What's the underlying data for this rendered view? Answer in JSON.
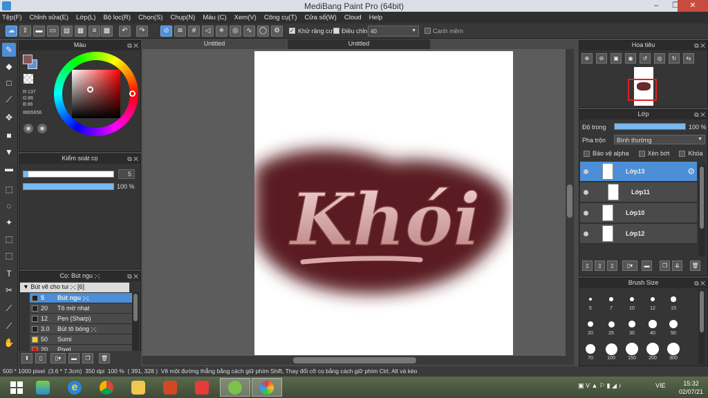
{
  "window": {
    "title": "MediBang Paint Pro (64bit)",
    "minimize": "‒",
    "maximize": "❐",
    "close": "✕"
  },
  "menu": [
    "Tệp(F)",
    "Chỉnh sửa(E)",
    "Lớp(L)",
    "Bộ lọc(R)",
    "Chọn(S)",
    "Chụp(N)",
    "Màu (C)",
    "Xem(V)",
    "Công cụ(T)",
    "Cửa sổ(W)",
    "Cloud",
    "Help"
  ],
  "toolbar": {
    "antialias_label": "Khử răng cưa",
    "antialias_checked": true,
    "correction_label": "Điều chỉnh",
    "correction_value": "40",
    "snap_label": "Canh mềm",
    "snap_checked": false
  },
  "color_panel": {
    "title": "Màu",
    "r": "R:137",
    "g": "G:86",
    "b": "B:86",
    "hex": "#895656",
    "primary_color": "#895656",
    "secondary_color": "#6a8fcf"
  },
  "brush_control": {
    "title": "Kiểm soát cọ",
    "size_value": "5",
    "opacity_value": "100 %",
    "size_fraction": 0.05,
    "opacity_fraction": 1.0
  },
  "brush_list": {
    "title": "Cọ: Bút ngu ;-;",
    "folder": "Bút vẽ cho tui ;-; [6]",
    "items": [
      {
        "size": "5",
        "name": "Bút ngu ;-;",
        "color": "#222222",
        "selected": true
      },
      {
        "size": "20",
        "name": "Tô mờ nhạt",
        "color": "#222222",
        "selected": false
      },
      {
        "size": "12",
        "name": "Pen (Sharp)",
        "color": "#222222",
        "selected": false
      },
      {
        "size": "3.0",
        "name": "Bút tô bóng ;-;",
        "color": "#222222",
        "selected": false
      },
      {
        "size": "50",
        "name": "Sumi",
        "color": "#f0d020",
        "selected": false
      },
      {
        "size": "20",
        "name": "Pixel",
        "color": "#d02020",
        "selected": false
      }
    ]
  },
  "tabs": [
    "Untitled",
    "Untitled"
  ],
  "navigator": {
    "title": "Hoa tiêu"
  },
  "layers": {
    "title": "Lớp",
    "opacity_label": "Độ trong",
    "opacity_value": "100 %",
    "opacity_fraction": 1.0,
    "blend_label": "Pha trộn",
    "blend_value": "Bình thường",
    "protect_alpha": "Bảo vệ alpha",
    "clip": "Xén bớt",
    "lock": "Khóa",
    "items": [
      {
        "name": "Lớp13",
        "selected": true
      },
      {
        "name": "Lớp11",
        "selected": false
      },
      {
        "name": "Lớp10",
        "selected": false
      },
      {
        "name": "Lớp12",
        "selected": false
      }
    ]
  },
  "brush_size": {
    "title": "Brush Size",
    "sizes": [
      "5",
      "7",
      "10",
      "12",
      "15",
      "20",
      "25",
      "30",
      "40",
      "50",
      "70",
      "100",
      "150",
      "200",
      "300"
    ]
  },
  "artwork": {
    "text": "Khói"
  },
  "status": {
    "dimensions": "500 * 1000 pixel",
    "physical": "(3.6 * 7.3cm)",
    "dpi": "350 dpi",
    "zoom": "100 %",
    "cursor": "( 391, 328 )",
    "hint": "Vẽ một đường thẳng bằng cách giữ phím Shift, Thay đổi cỡ cọ bằng cách giữ phím Ctrl, Alt và kéo"
  },
  "taskbar": {
    "lang": "VIE",
    "time": "15:32",
    "date": "02/07/21"
  }
}
